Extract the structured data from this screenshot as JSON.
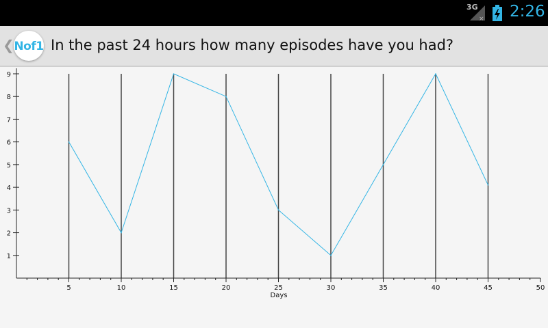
{
  "status_bar": {
    "network": "3G",
    "time": "2:26",
    "icons": [
      "signal-icon",
      "battery-charging-icon"
    ],
    "accent_color": "#33b5e5"
  },
  "action_bar": {
    "logo_text": "Nof1",
    "title": "In the past 24 hours how many episodes have you had?"
  },
  "chart_data": {
    "type": "line",
    "x": [
      5,
      10,
      15,
      20,
      25,
      30,
      35,
      40,
      45
    ],
    "series": [
      {
        "values": [
          6,
          2,
          9,
          8,
          3,
          1,
          5,
          9,
          4.1
        ]
      }
    ],
    "xlabel": "Days",
    "ylabel": "",
    "xlim": [
      0,
      50
    ],
    "ylim": [
      0,
      9
    ],
    "xticks": [
      "5",
      "10",
      "15",
      "20",
      "25",
      "30",
      "35",
      "40",
      "45",
      "50"
    ],
    "yticks": [
      "1",
      "2",
      "3",
      "4",
      "5",
      "6",
      "7",
      "8",
      "9"
    ],
    "grid": "vertical lines at labelled x ticks",
    "line_color": "#33b5e5",
    "grid_color": "#444444"
  }
}
